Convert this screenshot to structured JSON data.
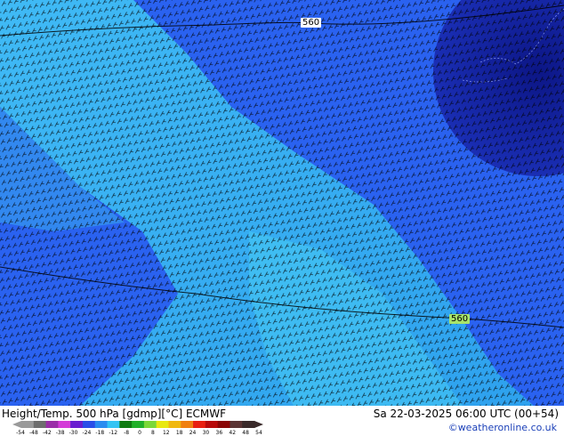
{
  "map": {
    "contour_labels": [
      "560",
      "560"
    ]
  },
  "footer": {
    "title": "Height/Temp. 500 hPa [gdmp][°C] ECMWF",
    "datetime": "Sa 22-03-2025 06:00 UTC (00+54)",
    "credit": "©weatheronline.co.uk"
  },
  "legend": {
    "ticks": [
      "-54",
      "-48",
      "-42",
      "-38",
      "-30",
      "-24",
      "-18",
      "-12",
      "-8",
      "0",
      "8",
      "12",
      "18",
      "24",
      "30",
      "36",
      "42",
      "48",
      "54"
    ],
    "colors": [
      "#9a9a9a",
      "#6e6e6e",
      "#9a2ea8",
      "#d43cd8",
      "#6a1ed0",
      "#2a4ee8",
      "#2a8cf0",
      "#34c4f4",
      "#0e7a10",
      "#20b028",
      "#7ad838",
      "#e8e810",
      "#f0b810",
      "#f08010",
      "#e82010",
      "#b80a0a",
      "#8a0606",
      "#5a3434",
      "#3a2a2a"
    ]
  },
  "colors": {
    "ocean_blue": "#2a5ef2",
    "light_blue": "#3cb4f2",
    "cold_core": "#1222a0",
    "barb_ink": "#000000"
  }
}
